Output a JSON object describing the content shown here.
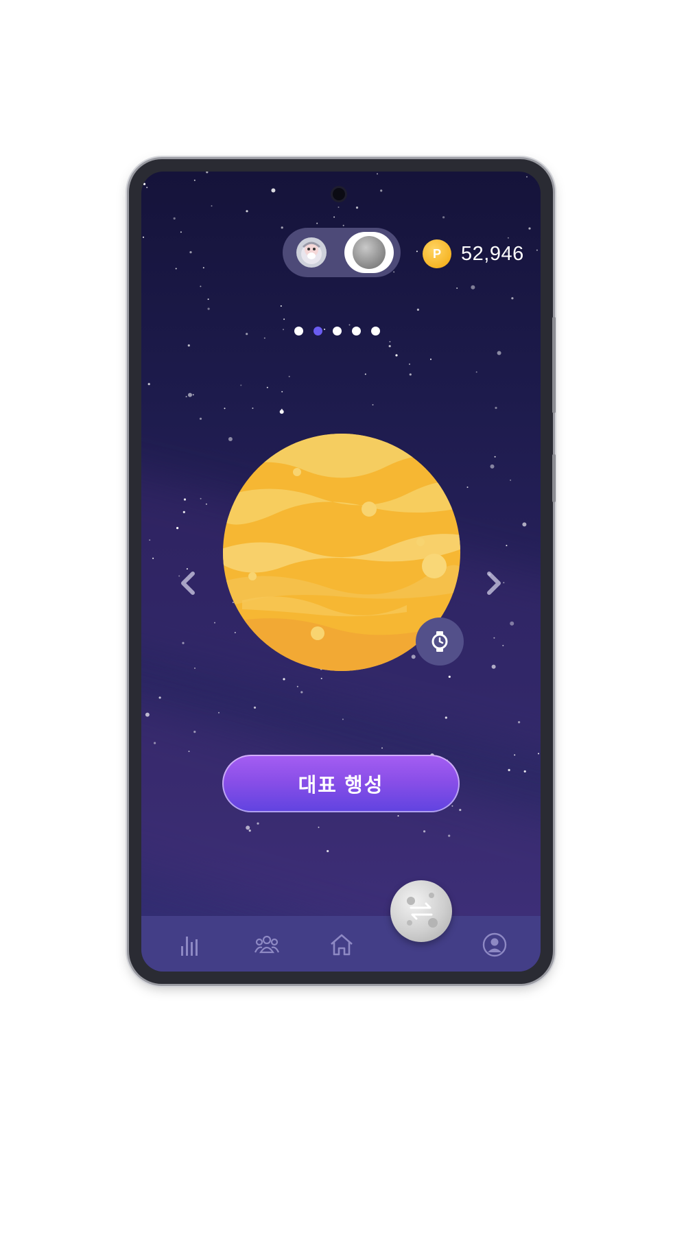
{
  "header": {
    "points_icon_letter": "P",
    "points_value": "52,946"
  },
  "pager": {
    "total": 5,
    "active_index": 1
  },
  "main_button": {
    "label": "대표 행성"
  },
  "icons": {
    "prev": "chevron-left-icon",
    "next": "chevron-right-icon",
    "watch": "watch-icon",
    "swap": "swap-arrows-icon",
    "nav": [
      "bar-chart-icon",
      "group-icon",
      "home-icon",
      "planet-swap-icon",
      "profile-icon"
    ]
  },
  "colors": {
    "pager_active": "#6a5cf0",
    "button_gradient_top": "#a55ef2",
    "button_gradient_bottom": "#5f43e0",
    "planet": "#f6b733",
    "coin": "#f6b526",
    "navbar": "#433e87"
  }
}
